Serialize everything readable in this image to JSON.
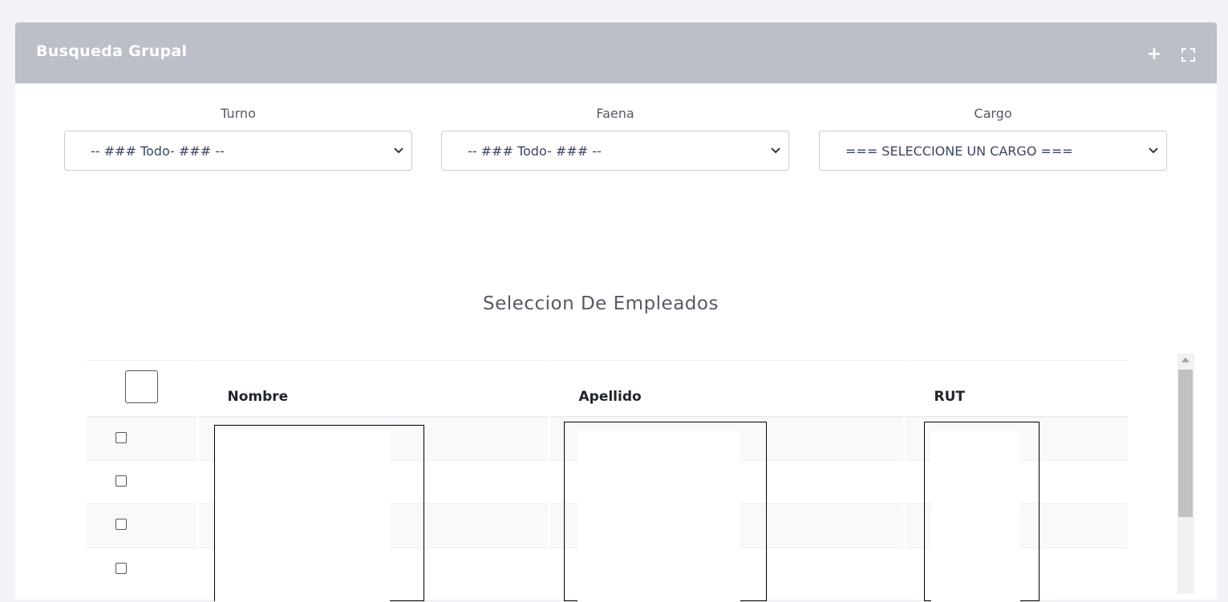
{
  "card": {
    "title": "Busqueda Grupal",
    "tools": [
      {
        "name": "plus-icon",
        "glyph": "+"
      },
      {
        "name": "fullscreen-icon"
      }
    ]
  },
  "filters": {
    "turno": {
      "label": "Turno",
      "value": "-- ### Todo- ### --"
    },
    "faena": {
      "label": "Faena",
      "value": "-- ### Todo- ### --"
    },
    "cargo": {
      "label": "Cargo",
      "value": "=== SELECCIONE UN CARGO ==="
    }
  },
  "section": {
    "title": "Seleccion De Empleados"
  },
  "table": {
    "columns": [
      "Nombre",
      "Apellido",
      "RUT"
    ],
    "rows": [
      {
        "checked": false
      },
      {
        "checked": false
      },
      {
        "checked": false
      },
      {
        "checked": false
      }
    ]
  },
  "colors": {
    "header_bg": "#bbbfc8",
    "page_bg": "#f2f3f8",
    "select_text": "#3a4565"
  }
}
